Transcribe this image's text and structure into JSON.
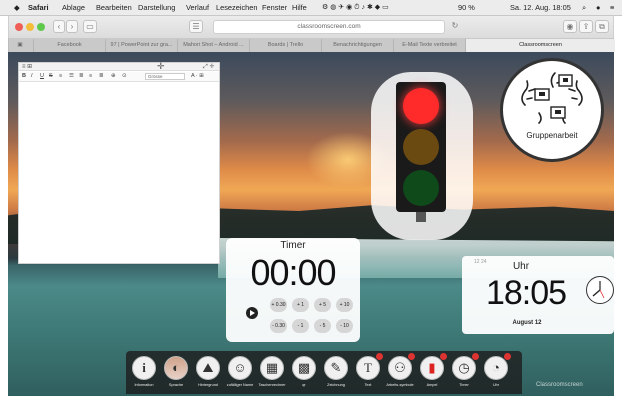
{
  "menubar": {
    "apple": "",
    "app": "Safari",
    "items": [
      "Ablage",
      "Bearbeiten",
      "Darstellung",
      "Verlauf",
      "Lesezeichen",
      "Fenster",
      "Hilfe"
    ],
    "status": "90 % ",
    "datetime": "Sa. 12. Aug. 18:05"
  },
  "toolbar": {
    "url": "classroomscreen.com",
    "back": "‹",
    "forward": "›"
  },
  "tabs": [
    "Facebook",
    "97 | PowerPoint zur gra...",
    "Mahori Shot – Android ...",
    "Boards | Trello",
    "Benachrichtigungen",
    "E-Mail Texte verbreitet",
    "Classroomscreen"
  ],
  "editor": {
    "menu_left": "≡ ⊞",
    "menu_right": "⤢ ✛",
    "format": [
      "B",
      "I",
      "U",
      "S",
      "≡",
      "☰",
      "≣",
      "≡",
      "≣",
      "⊕",
      "⊙"
    ],
    "style_select": "Grösse",
    "extra": "A · ⊞"
  },
  "group": {
    "label": "Gruppenarbeit"
  },
  "timer": {
    "title": "Timer",
    "value": "00:00",
    "steps_up": [
      "+ 0.30",
      "+ 1",
      "+ 5",
      "+ 10"
    ],
    "steps_down": [
      "- 0.30",
      "- 1",
      "- 5",
      "- 10"
    ]
  },
  "clock": {
    "title": "Uhr",
    "time": "18:05",
    "date": "August 12",
    "options": "12  24"
  },
  "traffic": {
    "active": "red",
    "colors": {
      "red": "#ff2a2a",
      "yellow": "#6b4a12",
      "green": "#0f4a1a"
    }
  },
  "dock": {
    "items": [
      {
        "icon": "i",
        "label": "Information"
      },
      {
        "icon": "◐",
        "label": "Sprache"
      },
      {
        "icon": "⛰",
        "label": "Hintergrund"
      },
      {
        "icon": "☺",
        "label": "zufälliger Name"
      },
      {
        "icon": "▦",
        "label": "Taschenrechner"
      },
      {
        "icon": "▩",
        "label": "qr"
      },
      {
        "icon": "✎",
        "label": "Zeichnung"
      },
      {
        "icon": "T",
        "label": "Text"
      },
      {
        "icon": "⚇",
        "label": "Arbeits-symbole"
      },
      {
        "icon": "▮",
        "label": "Ampel"
      },
      {
        "icon": "◷",
        "label": "Timer"
      },
      {
        "icon": "◔",
        "label": "Uhr"
      }
    ]
  },
  "watermark": "Classroomscreen"
}
